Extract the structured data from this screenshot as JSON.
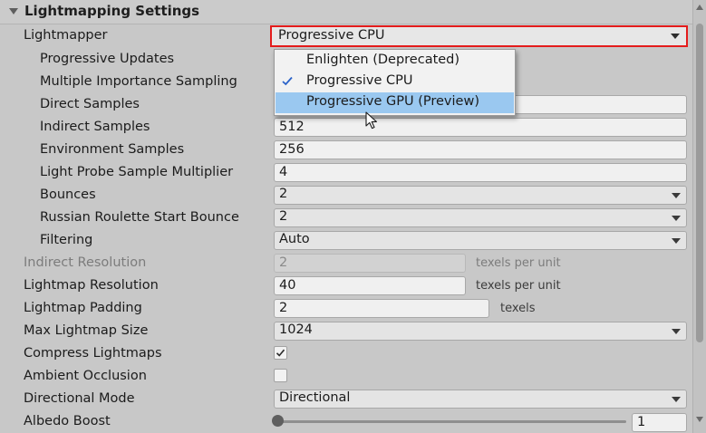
{
  "header": {
    "title": "Lightmapping Settings"
  },
  "lightmapper": {
    "label": "Lightmapper",
    "value": "Progressive CPU"
  },
  "dropdown_menu": {
    "items": [
      {
        "label": "Enlighten (Deprecated)",
        "checked": false,
        "highlighted": false
      },
      {
        "label": "Progressive CPU",
        "checked": true,
        "highlighted": false
      },
      {
        "label": "Progressive GPU (Preview)",
        "checked": false,
        "highlighted": true
      }
    ],
    "highlight_color": "#9ac8f0"
  },
  "settings": {
    "progressive_updates": {
      "label": "Progressive Updates"
    },
    "multiple_importance_sampling": {
      "label": "Multiple Importance Sampling"
    },
    "direct_samples": {
      "label": "Direct Samples"
    },
    "indirect_samples": {
      "label": "Indirect Samples",
      "value": "512"
    },
    "environment_samples": {
      "label": "Environment Samples",
      "value": "256"
    },
    "light_probe_multiplier": {
      "label": "Light Probe Sample Multiplier",
      "value": "4"
    },
    "bounces": {
      "label": "Bounces",
      "value": "2"
    },
    "russian_roulette": {
      "label": "Russian Roulette Start Bounce",
      "value": "2"
    },
    "filtering": {
      "label": "Filtering",
      "value": "Auto"
    },
    "indirect_resolution": {
      "label": "Indirect Resolution",
      "value": "2",
      "unit": "texels per unit"
    },
    "lightmap_resolution": {
      "label": "Lightmap Resolution",
      "value": "40",
      "unit": "texels per unit"
    },
    "lightmap_padding": {
      "label": "Lightmap Padding",
      "value": "2",
      "unit": "texels"
    },
    "max_lightmap_size": {
      "label": "Max Lightmap Size",
      "value": "1024"
    },
    "compress_lightmaps": {
      "label": "Compress Lightmaps",
      "checked": true
    },
    "ambient_occlusion": {
      "label": "Ambient Occlusion",
      "checked": false
    },
    "directional_mode": {
      "label": "Directional Mode",
      "value": "Directional"
    },
    "albedo_boost": {
      "label": "Albedo Boost",
      "value": "1"
    }
  },
  "colors": {
    "highlight_border": "#e41c1c",
    "panel_bg": "#c8c8c8"
  }
}
